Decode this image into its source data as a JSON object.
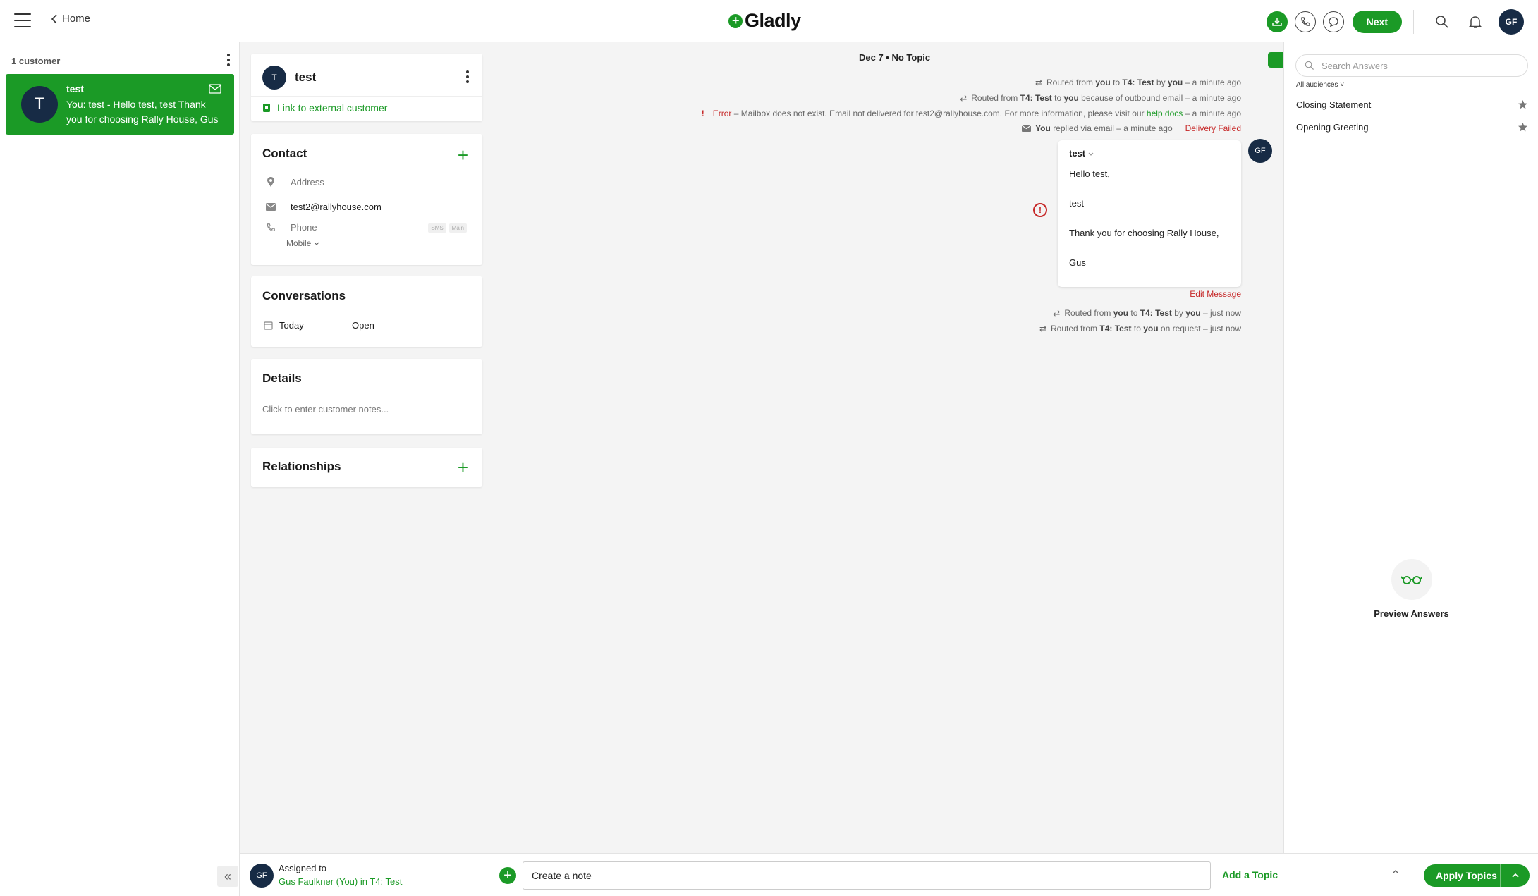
{
  "topbar": {
    "home_label": "Home",
    "logo_text": "Gladly",
    "next_label": "Next",
    "user_initials": "GF",
    "icons": [
      "menu-icon",
      "chevron-left-icon",
      "inbox-icon",
      "phone-icon",
      "chat-icon",
      "search-icon",
      "bell-icon"
    ]
  },
  "customer_list": {
    "count_label": "1 customer",
    "items": [
      {
        "initial": "T",
        "name": "test",
        "preview": "You: test - Hello test, test Thank you for choosing Rally House, Gus"
      }
    ]
  },
  "profile": {
    "initial": "T",
    "name": "test",
    "link_external": "Link to external customer",
    "contact": {
      "title": "Contact",
      "address_placeholder": "Address",
      "email": "test2@rallyhouse.com",
      "phone_placeholder": "Phone",
      "sms_tag": "SMS",
      "main_tag": "Main",
      "phone_type": "Mobile"
    },
    "conversations": {
      "title": "Conversations",
      "rows": [
        {
          "date": "Today",
          "status": "Open"
        }
      ]
    },
    "details": {
      "title": "Details",
      "notes_placeholder": "Click to enter customer notes..."
    },
    "relationships": {
      "title": "Relationships"
    }
  },
  "conversation": {
    "date_header": "Dec 7 • No Topic",
    "events_top": {
      "e1": {
        "pre": "Routed from",
        "you": "you",
        "to": "to",
        "team": "T4: Test",
        "by": "by",
        "who": "you",
        "time": "– a minute ago"
      },
      "e2": {
        "pre": "Routed from",
        "team": "T4: Test",
        "to": "to",
        "who": "you",
        "reason": "because of outbound email",
        "time": "– a minute ago"
      },
      "e3": {
        "label": "Error",
        "text": "– Mailbox does not exist. Email not delivered for test2@rallyhouse.com. For more information, please visit our",
        "link": "help docs",
        "time": "– a minute ago"
      },
      "e4": {
        "who": "You",
        "text": "replied via email",
        "time": "– a minute ago",
        "status": "Delivery Failed"
      }
    },
    "message": {
      "from": "test",
      "lines": [
        "Hello test,",
        "test",
        "Thank you for choosing Rally House,",
        "Gus"
      ],
      "agent_initials": "GF",
      "edit_label": "Edit Message"
    },
    "events_bottom": {
      "e5": {
        "pre": "Routed from",
        "you": "you",
        "to": "to",
        "team": "T4: Test",
        "by": "by",
        "who": "you",
        "time": "– just now"
      },
      "e6": {
        "pre": "Routed from",
        "team": "T4: Test",
        "to": "to",
        "who": "you",
        "reason": "on request",
        "time": "– just now"
      }
    }
  },
  "answers": {
    "search_placeholder": "Search Answers",
    "audiences": "All audiences",
    "items": [
      {
        "label": "Closing Statement"
      },
      {
        "label": "Opening Greeting"
      }
    ],
    "preview_label": "Preview Answers"
  },
  "bottombar": {
    "assigned_label": "Assigned to",
    "assigned_value": "Gus Faulkner (You) in T4: Test",
    "assignee_initials": "GF",
    "note_placeholder": "Create a note",
    "add_topic": "Add a Topic",
    "apply_topics": "Apply Topics"
  },
  "colors": {
    "accent": "#1b9a26",
    "avatar": "#172b45",
    "error": "#c62828"
  }
}
